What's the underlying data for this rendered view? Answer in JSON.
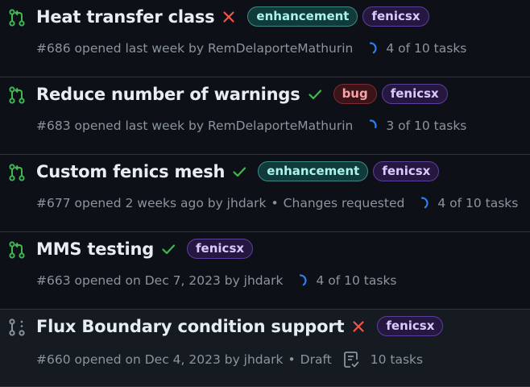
{
  "colors": {
    "open_pr": "#3fb950",
    "draft_pr": "#8b949e",
    "check_success": "#3fb950",
    "check_fail": "#f85149",
    "progress": "#2f81f7"
  },
  "pulls": [
    {
      "title": "Heat transfer class",
      "pr_state_icon": "git-pull-request-icon",
      "check_status": "fail",
      "labels": [
        {
          "name": "enhancement",
          "kind": "enhancement"
        },
        {
          "name": "fenicsx",
          "kind": "fenicsx"
        }
      ],
      "meta": "#686 opened last week by RemDelaporteMathurin",
      "review_status": "",
      "tasks": {
        "text": "4 of 10 tasks",
        "done": 4,
        "total": 10
      }
    },
    {
      "title": "Reduce number of warnings",
      "pr_state_icon": "git-pull-request-icon",
      "check_status": "success",
      "labels": [
        {
          "name": "bug",
          "kind": "bug"
        },
        {
          "name": "fenicsx",
          "kind": "fenicsx"
        }
      ],
      "meta": "#683 opened last week by RemDelaporteMathurin",
      "review_status": "",
      "tasks": {
        "text": "3 of 10 tasks",
        "done": 3,
        "total": 10
      }
    },
    {
      "title": "Custom fenics mesh",
      "pr_state_icon": "git-pull-request-icon",
      "check_status": "success",
      "labels": [
        {
          "name": "enhancement",
          "kind": "enhancement"
        },
        {
          "name": "fenicsx",
          "kind": "fenicsx"
        }
      ],
      "meta": "#677 opened 2 weeks ago by jhdark",
      "review_status": "Changes requested",
      "tasks": {
        "text": "4 of 10 tasks",
        "done": 4,
        "total": 10
      }
    },
    {
      "title": "MMS testing",
      "pr_state_icon": "git-pull-request-icon",
      "check_status": "success",
      "labels": [
        {
          "name": "fenicsx",
          "kind": "fenicsx"
        }
      ],
      "meta": "#663 opened on Dec 7, 2023 by jhdark",
      "review_status": "",
      "tasks": {
        "text": "4 of 10 tasks",
        "done": 4,
        "total": 10
      }
    },
    {
      "title": "Flux Boundary condition support",
      "pr_state_icon": "git-pull-request-draft-icon",
      "check_status": "fail",
      "labels": [
        {
          "name": "fenicsx",
          "kind": "fenicsx"
        }
      ],
      "meta": "#660 opened on Dec 4, 2023 by jhdark",
      "review_status": "Draft",
      "tasks": {
        "text": "10 tasks",
        "done": 0,
        "total": 10,
        "icon": "checklist-icon"
      }
    }
  ]
}
